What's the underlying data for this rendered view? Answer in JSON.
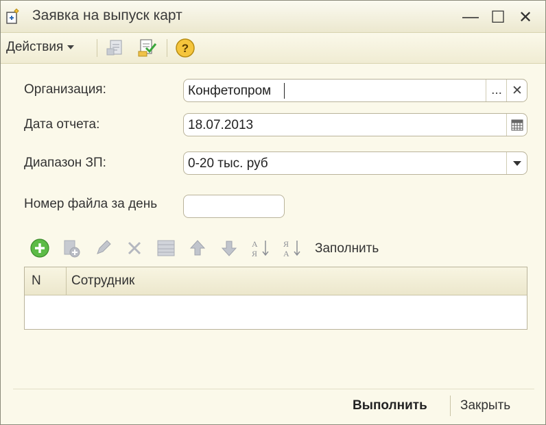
{
  "window": {
    "title": "Заявка на выпуск карт",
    "minimize_symbol": "—",
    "maximize_symbol": "☐",
    "close_symbol": "✕"
  },
  "toolbar": {
    "actions_label": "Действия",
    "icons": [
      "post-document-icon",
      "post-and-close-icon",
      "help-icon"
    ],
    "help_symbol": "?"
  },
  "form": {
    "organization": {
      "label": "Организация:",
      "value": "Конфетопром",
      "select_symbol": "...",
      "clear_symbol": "✕"
    },
    "report_date": {
      "label": "Дата отчета:",
      "value": "18.07.2013"
    },
    "salary_range": {
      "label": "Диапазон ЗП:",
      "value": "0-20 тыс. руб"
    },
    "file_number": {
      "label": "Номер файла за день",
      "value": ""
    }
  },
  "table_toolbar": {
    "icons": [
      "add-icon",
      "copy-icon",
      "edit-icon",
      "delete-icon",
      "table-settings-icon",
      "move-up-icon",
      "move-down-icon",
      "sort-ascending-icon",
      "sort-descending-icon"
    ],
    "fill_label": "Заполнить"
  },
  "table": {
    "columns": [
      "N",
      "Сотрудник"
    ],
    "rows": []
  },
  "footer": {
    "execute_label": "Выполнить",
    "close_label": "Закрыть"
  },
  "colors": {
    "window_bg": "#fbf9ea",
    "add_icon": "#4caf3c",
    "help_icon": "#f0b630",
    "disabled_icon": "#b9bcc4"
  }
}
